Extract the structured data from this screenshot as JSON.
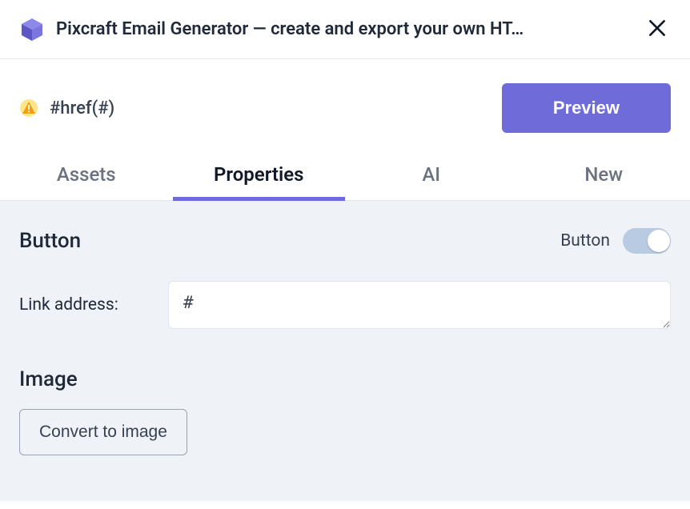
{
  "header": {
    "title": "Pixcraft Email Generator — create and export your own HT…"
  },
  "subheader": {
    "element_ref": "#href(#)",
    "preview_label": "Preview"
  },
  "tabs": [
    {
      "label": "Assets",
      "active": false
    },
    {
      "label": "Properties",
      "active": true
    },
    {
      "label": "AI",
      "active": false
    },
    {
      "label": "New",
      "active": false
    }
  ],
  "properties": {
    "section_heading": "Button",
    "toggle_label": "Button",
    "toggle_on": true,
    "link_label": "Link address:",
    "link_value": "#",
    "image_heading": "Image",
    "convert_label": "Convert to image"
  },
  "colors": {
    "accent": "#6f6cd9",
    "panel_bg": "#eff3f8"
  }
}
